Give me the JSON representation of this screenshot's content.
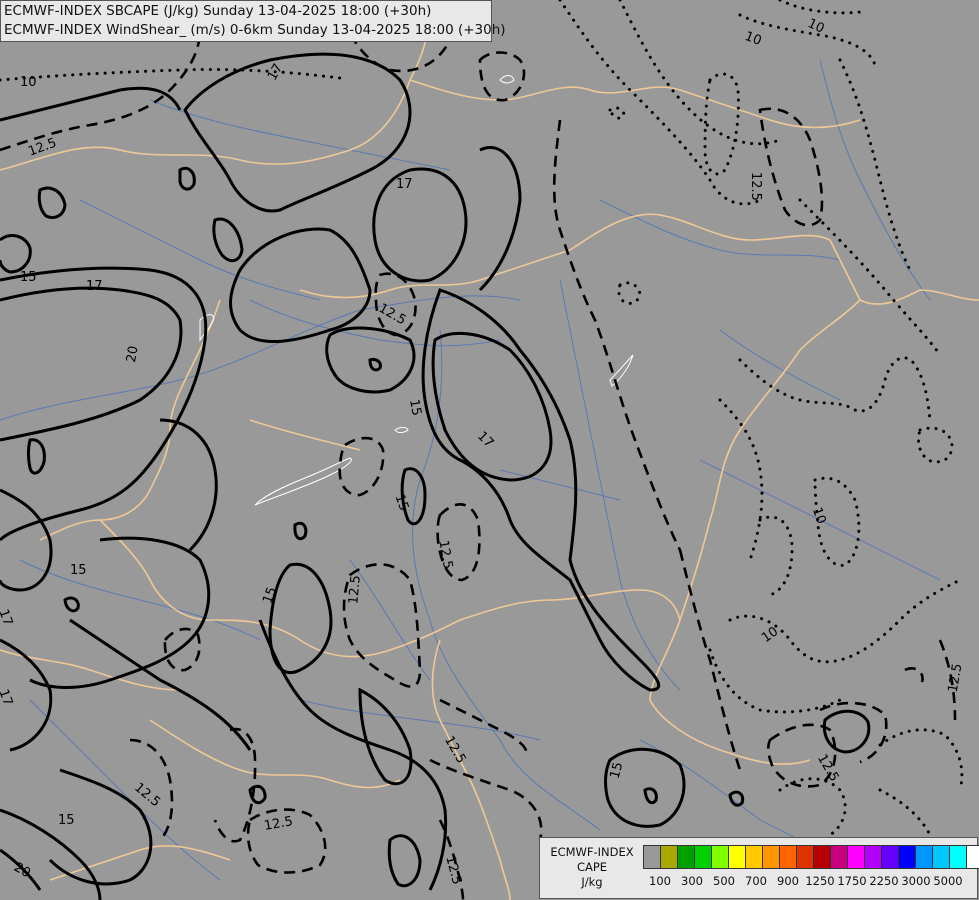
{
  "header": {
    "line1": "ECMWF-INDEX SBCAPE (J/kg) Sunday 13-04-2025 18:00 (+30h)",
    "line2": "ECMWF-INDEX WindShear_ (m/s) 0-6km Sunday 13-04-2025 18:00 (+30h)"
  },
  "legend": {
    "title_lines": [
      "ECMWF-INDEX",
      "CAPE",
      "J/kg"
    ],
    "swatch_colors": [
      "#999999",
      "#a8a800",
      "#00a000",
      "#00d000",
      "#80ff00",
      "#ffff00",
      "#ffc800",
      "#ff9600",
      "#ff6400",
      "#e03200",
      "#b40000",
      "#c80080",
      "#ff00ff",
      "#b400ff",
      "#6400ff",
      "#0000ff",
      "#0096ff",
      "#00c8ff",
      "#00ffff",
      "#ffffff"
    ],
    "ticks": [
      "100",
      "300",
      "500",
      "700",
      "900",
      "1250",
      "1750",
      "2250",
      "3000",
      "5000"
    ]
  },
  "map": {
    "background_color": "#999999",
    "contour_labels": {
      "c1": "10",
      "c2": "17",
      "c3": "10",
      "c4": "10",
      "c5": "12.5",
      "c6": "17",
      "c7": "12.5",
      "c8": "15",
      "c9": "17",
      "c10": "20",
      "c11": "12.5",
      "c12": "15",
      "c13": "17",
      "c14": "15",
      "c15": "12.5",
      "c16": "10",
      "c17": "15",
      "c18": "12.5",
      "c19": "15",
      "c20": "17",
      "c21": "17",
      "c22": "10",
      "c23": "12.5",
      "c24": "12.5",
      "c25": "12.5",
      "c26": "12.5",
      "c27": "12.5",
      "c28": "15",
      "c29": "15",
      "c30": "20",
      "c31": "12.5"
    }
  }
}
